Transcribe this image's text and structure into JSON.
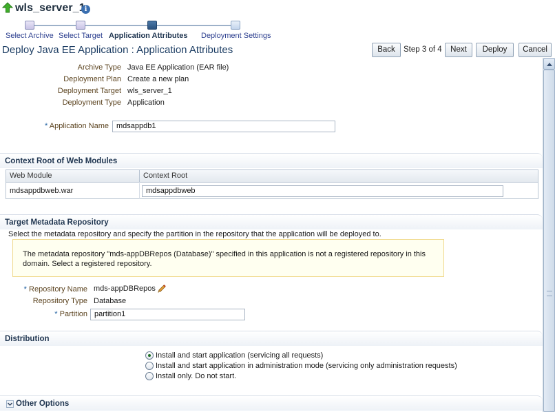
{
  "header": {
    "title": "wls_server_1"
  },
  "train": {
    "steps": [
      {
        "label": "Select Archive"
      },
      {
        "label": "Select Target"
      },
      {
        "label": "Application Attributes"
      },
      {
        "label": "Deployment Settings"
      }
    ]
  },
  "page": {
    "title": "Deploy Java EE Application : Application Attributes",
    "step_indicator": "Step 3 of 4"
  },
  "buttons": {
    "back": "Back",
    "next": "Next",
    "deploy": "Deploy",
    "cancel": "Cancel"
  },
  "summary": [
    {
      "label": "Archive Type",
      "value": "Java EE Application (EAR file)"
    },
    {
      "label": "Deployment Plan",
      "value": "Create a new plan"
    },
    {
      "label": "Deployment Target",
      "value": "wls_server_1"
    },
    {
      "label": "Deployment Type",
      "value": "Application"
    }
  ],
  "app_name": {
    "required": "*",
    "label": "Application Name",
    "value": "mdsappdb1"
  },
  "context_root": {
    "section_title": "Context Root of Web Modules",
    "columns": [
      "Web Module",
      "Context Root"
    ],
    "rows": [
      {
        "module": "mdsappdbweb.war",
        "root": "mdsappdbweb"
      }
    ]
  },
  "metadata": {
    "section_title": "Target Metadata Repository",
    "description": "Select the metadata repository and specify the partition in the repository that the application will be deployed to.",
    "warning": "The metadata repository \"mds-appDBRepos (Database)\" specified in this application is not a registered repository in this domain. Select a registered repository.",
    "repo_name_label": "Repository Name",
    "repo_name_value": "mds-appDBRepos",
    "repo_type_label": "Repository Type",
    "repo_type_value": "Database",
    "partition_label": "Partition",
    "partition_value": "partition1"
  },
  "distribution": {
    "section_title": "Distribution",
    "options": [
      {
        "label": "Install and start application (servicing all requests)",
        "selected": true
      },
      {
        "label": "Install and start application in administration mode (servicing only administration requests)",
        "selected": false
      },
      {
        "label": "Install only. Do not start.",
        "selected": false
      }
    ]
  },
  "other_options": {
    "section_title": "Other Options"
  },
  "colors": {
    "accent": "#1c3d63",
    "label": "#5c4420",
    "warning_bg": "#fffff0",
    "warning_border": "#f0d98c"
  }
}
